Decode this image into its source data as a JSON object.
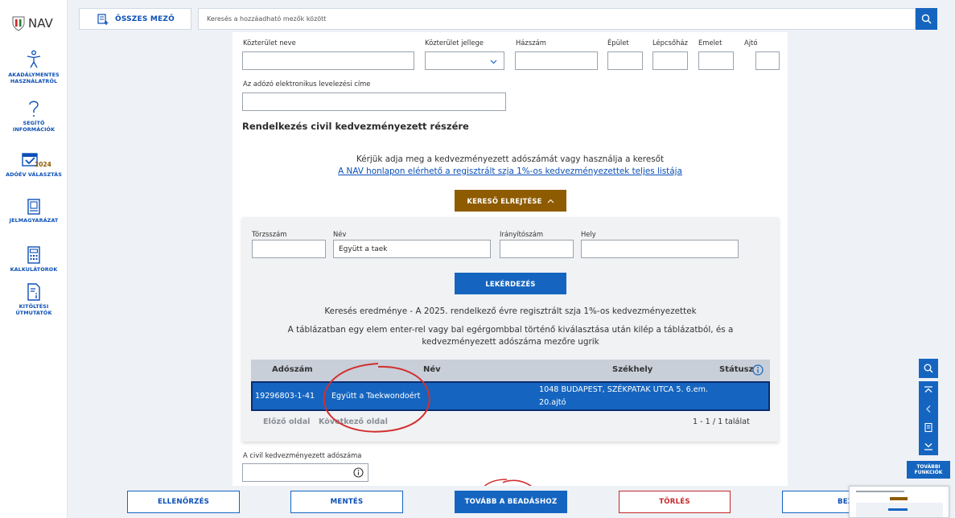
{
  "brand": {
    "logo_text": "NAV"
  },
  "sidebar": {
    "items": [
      {
        "label_line1": "AKADÁLYMENTES",
        "label_line2": "HASZNÁLATRÓL"
      },
      {
        "label_line1": "SEGÍTŐ",
        "label_line2": "INFORMÁCIÓK"
      },
      {
        "label_line1": "ADÓÉV VÁLASZTÁS",
        "label_line2": "",
        "badge": "2024"
      },
      {
        "label_line1": "JELMAGYARÁZAT",
        "label_line2": ""
      },
      {
        "label_line1": "KALKULÁTOROK",
        "label_line2": ""
      },
      {
        "label_line1": "KITÖLTÉSI",
        "label_line2": "ÚTMUTATÓK"
      }
    ]
  },
  "topbar": {
    "all_fields_label": "ÖSSZES MEZŐ",
    "search_placeholder": "Keresés a hozzáadható mezők között"
  },
  "address": {
    "street_name_label": "Közterület neve",
    "street_type_label": "Közterület jellege",
    "house_number_label": "Házszám",
    "building_label": "Épület",
    "staircase_label": "Lépcsőház",
    "floor_label": "Emelet",
    "door_label": "Ajtó",
    "email_label": "Az adózó elektronikus levelezési címe"
  },
  "civil": {
    "section_title": "Rendelkezés civil kedvezményezett részére",
    "instruction": "Kérjük adja meg a kedvezményezett adószámát vagy használja a keresőt",
    "list_link": "A NAV honlapon elérhető a regisztrált szja 1%-os kedvezményezettek teljes listája",
    "hide_search_label": "KERESŐ ELREJTÉSE",
    "search": {
      "reg_number_label": "Törzsszám",
      "name_label": "Név",
      "name_value": "Együtt a taek",
      "zip_label": "Irányítószám",
      "place_label": "Hely",
      "query_button": "LEKÉRDEZÉS"
    },
    "results_title": "Keresés eredménye - A 2025. rendelkező évre regisztrált szja 1%-os kedvezményezettek",
    "results_hint_line1": "A táblázatban egy elem enter-rel vagy bal egérgombbal történő kiválasztása után kilép a táblázatból, és a",
    "results_hint_line2": "kedvezményezett adószáma mezőre ugrik",
    "table": {
      "headers": {
        "tax_number": "Adószám",
        "name": "Név",
        "seat": "Székhely",
        "status": "Státusz"
      },
      "rows": [
        {
          "tax_number": "19296803-1-41",
          "name": "Együtt a Taekwondoért",
          "seat_line1": "1048 BUDAPEST, SZÉKPATAK UTCA 5. 6.em.",
          "seat_line2": "20.ajtó",
          "status": ""
        }
      ]
    },
    "pager": {
      "prev": "Előző oldal",
      "next": "Következő oldal",
      "hits": "1 - 1 / 1 találat"
    },
    "beneficiary_tax_label": "A civil kedvezményezett adószáma"
  },
  "bottom": {
    "check": "ELLENŐRZÉS",
    "save": "MENTÉS",
    "submit": "TOVÁBB A BEADÁSHOZ",
    "delete": "TÖRLÉS",
    "close": "BEZÁRÁS"
  },
  "right_tools": {
    "more_line1": "TOVÁBBI",
    "more_line2": "FUNKCIÓK"
  },
  "colors": {
    "primary": "#1565c0",
    "brand_brown": "#8e5b00",
    "danger": "#c62828",
    "annotation": "#d32f2f"
  }
}
